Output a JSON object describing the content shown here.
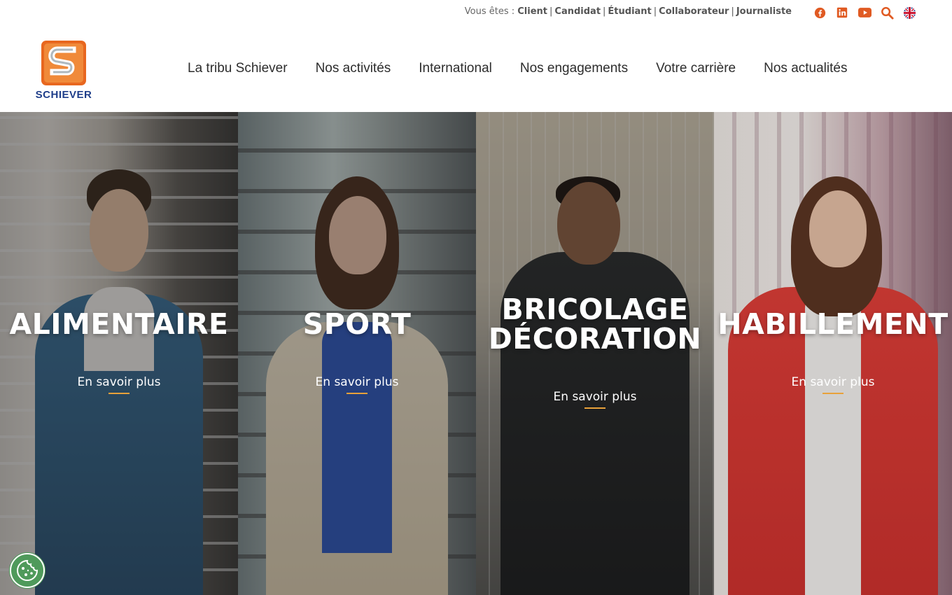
{
  "topbar": {
    "prefix": "Vous êtes :",
    "audiences": [
      "Client",
      "Candidat",
      "Étudiant",
      "Collaborateur",
      "Journaliste"
    ]
  },
  "social": {
    "icons": [
      "facebook-icon",
      "linkedin-icon",
      "youtube-icon",
      "search-icon",
      "uk-flag-icon"
    ],
    "accent": "#e05a22"
  },
  "logo": {
    "text": "SCHIEVER",
    "brand_orange": "#e8671f",
    "brand_blue": "#1f3e8a"
  },
  "nav": {
    "items": [
      "La tribu Schiever",
      "Nos activités",
      "International",
      "Nos engagements",
      "Votre carrière",
      "Nos actualités"
    ]
  },
  "panels": [
    {
      "title_lines": [
        "ALIMENTAIRE"
      ],
      "link": "En savoir plus"
    },
    {
      "title_lines": [
        "SPORT"
      ],
      "link": "En savoir plus"
    },
    {
      "title_lines": [
        "BRICOLAGE",
        "DÉCORATION"
      ],
      "link": "En savoir plus"
    },
    {
      "title_lines": [
        "HABILLEMENT"
      ],
      "link": "En savoir plus"
    }
  ],
  "colors": {
    "underline": "#e8a13a",
    "cookie": "#4f9a5b"
  }
}
